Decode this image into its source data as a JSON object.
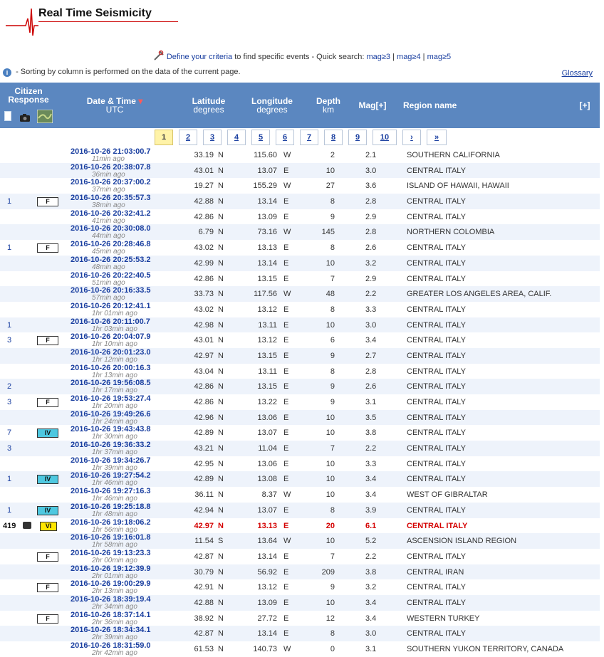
{
  "brand": {
    "title": "Real Time Seismicity"
  },
  "criteria": {
    "define_link": "Define your criteria",
    "text_mid": " to find specific events - Quick search: ",
    "mag3": "mag≥3",
    "mag4": "mag≥4",
    "mag5": "mag≥5",
    "sep": " | "
  },
  "info": {
    "text": "- Sorting by column is performed on the data of the current page.",
    "glossary": "Glossary"
  },
  "header": {
    "citizen": "Citizen",
    "response": "Response",
    "datetime": "Date & Time",
    "utc": "UTC",
    "latitude": "Latitude",
    "lat_unit": "degrees",
    "longitude": "Longitude",
    "lon_unit": "degrees",
    "depth": "Depth",
    "depth_unit": "km",
    "mag": "Mag[+]",
    "region": "Region name",
    "expand": "[+]",
    "sort_arrow": "▾"
  },
  "pager": [
    "1",
    "2",
    "3",
    "4",
    "5",
    "6",
    "7",
    "8",
    "9",
    "10",
    "›",
    "»"
  ],
  "events": [
    {
      "dt": "2016-10-26   21:03:00.7",
      "ago": "11min ago",
      "cnt": "",
      "badge": "",
      "lat": "33.19",
      "ns": "N",
      "lon": "115.60",
      "ew": "W",
      "dep": "2",
      "mag": "2.1",
      "reg": "SOUTHERN CALIFORNIA"
    },
    {
      "dt": "2016-10-26   20:38:07.8",
      "ago": "36min ago",
      "cnt": "",
      "badge": "",
      "lat": "43.01",
      "ns": "N",
      "lon": "13.07",
      "ew": "E",
      "dep": "10",
      "mag": "3.0",
      "reg": "CENTRAL ITALY"
    },
    {
      "dt": "2016-10-26   20:37:00.2",
      "ago": "37min ago",
      "cnt": "",
      "badge": "",
      "lat": "19.27",
      "ns": "N",
      "lon": "155.29",
      "ew": "W",
      "dep": "27",
      "mag": "3.6",
      "reg": "ISLAND OF HAWAII, HAWAII"
    },
    {
      "dt": "2016-10-26   20:35:57.3",
      "ago": "38min ago",
      "cnt": "1",
      "badge": "F",
      "lat": "42.88",
      "ns": "N",
      "lon": "13.14",
      "ew": "E",
      "dep": "8",
      "mag": "2.8",
      "reg": "CENTRAL ITALY"
    },
    {
      "dt": "2016-10-26   20:32:41.2",
      "ago": "41min ago",
      "cnt": "",
      "badge": "",
      "lat": "42.86",
      "ns": "N",
      "lon": "13.09",
      "ew": "E",
      "dep": "9",
      "mag": "2.9",
      "reg": "CENTRAL ITALY"
    },
    {
      "dt": "2016-10-26   20:30:08.0",
      "ago": "44min ago",
      "cnt": "",
      "badge": "",
      "lat": "6.79",
      "ns": "N",
      "lon": "73.16",
      "ew": "W",
      "dep": "145",
      "mag": "2.8",
      "reg": "NORTHERN COLOMBIA"
    },
    {
      "dt": "2016-10-26   20:28:46.8",
      "ago": "45min ago",
      "cnt": "1",
      "badge": "F",
      "lat": "43.02",
      "ns": "N",
      "lon": "13.13",
      "ew": "E",
      "dep": "8",
      "mag": "2.6",
      "reg": "CENTRAL ITALY"
    },
    {
      "dt": "2016-10-26   20:25:53.2",
      "ago": "48min ago",
      "cnt": "",
      "badge": "",
      "lat": "42.99",
      "ns": "N",
      "lon": "13.14",
      "ew": "E",
      "dep": "10",
      "mag": "3.2",
      "reg": "CENTRAL ITALY"
    },
    {
      "dt": "2016-10-26   20:22:40.5",
      "ago": "51min ago",
      "cnt": "",
      "badge": "",
      "lat": "42.86",
      "ns": "N",
      "lon": "13.15",
      "ew": "E",
      "dep": "7",
      "mag": "2.9",
      "reg": "CENTRAL ITALY"
    },
    {
      "dt": "2016-10-26   20:16:33.5",
      "ago": "57min ago",
      "cnt": "",
      "badge": "",
      "lat": "33.73",
      "ns": "N",
      "lon": "117.56",
      "ew": "W",
      "dep": "48",
      "mag": "2.2",
      "reg": "GREATER LOS ANGELES AREA, CALIF."
    },
    {
      "dt": "2016-10-26   20:12:41.1",
      "ago": "1hr 01min ago",
      "cnt": "",
      "badge": "",
      "lat": "43.02",
      "ns": "N",
      "lon": "13.12",
      "ew": "E",
      "dep": "8",
      "mag": "3.3",
      "reg": "CENTRAL ITALY"
    },
    {
      "dt": "2016-10-26   20:11:00.7",
      "ago": "1hr 03min ago",
      "cnt": "1",
      "badge": "",
      "lat": "42.98",
      "ns": "N",
      "lon": "13.11",
      "ew": "E",
      "dep": "10",
      "mag": "3.0",
      "reg": "CENTRAL ITALY"
    },
    {
      "dt": "2016-10-26   20:04:07.9",
      "ago": "1hr 10min ago",
      "cnt": "3",
      "badge": "F",
      "lat": "43.01",
      "ns": "N",
      "lon": "13.12",
      "ew": "E",
      "dep": "6",
      "mag": "3.4",
      "reg": "CENTRAL ITALY"
    },
    {
      "dt": "2016-10-26   20:01:23.0",
      "ago": "1hr 12min ago",
      "cnt": "",
      "badge": "",
      "lat": "42.97",
      "ns": "N",
      "lon": "13.15",
      "ew": "E",
      "dep": "9",
      "mag": "2.7",
      "reg": "CENTRAL ITALY"
    },
    {
      "dt": "2016-10-26   20:00:16.3",
      "ago": "1hr 13min ago",
      "cnt": "",
      "badge": "",
      "lat": "43.04",
      "ns": "N",
      "lon": "13.11",
      "ew": "E",
      "dep": "8",
      "mag": "2.8",
      "reg": "CENTRAL ITALY"
    },
    {
      "dt": "2016-10-26   19:56:08.5",
      "ago": "1hr 17min ago",
      "cnt": "2",
      "badge": "",
      "lat": "42.86",
      "ns": "N",
      "lon": "13.15",
      "ew": "E",
      "dep": "9",
      "mag": "2.6",
      "reg": "CENTRAL ITALY"
    },
    {
      "dt": "2016-10-26   19:53:27.4",
      "ago": "1hr 20min ago",
      "cnt": "3",
      "badge": "F",
      "lat": "42.86",
      "ns": "N",
      "lon": "13.22",
      "ew": "E",
      "dep": "9",
      "mag": "3.1",
      "reg": "CENTRAL ITALY"
    },
    {
      "dt": "2016-10-26   19:49:26.6",
      "ago": "1hr 24min ago",
      "cnt": "",
      "badge": "",
      "lat": "42.96",
      "ns": "N",
      "lon": "13.06",
      "ew": "E",
      "dep": "10",
      "mag": "3.5",
      "reg": "CENTRAL ITALY"
    },
    {
      "dt": "2016-10-26   19:43:43.8",
      "ago": "1hr 30min ago",
      "cnt": "7",
      "badge": "IV",
      "lat": "42.89",
      "ns": "N",
      "lon": "13.07",
      "ew": "E",
      "dep": "10",
      "mag": "3.8",
      "reg": "CENTRAL ITALY"
    },
    {
      "dt": "2016-10-26   19:36:33.2",
      "ago": "1hr 37min ago",
      "cnt": "3",
      "badge": "",
      "lat": "43.21",
      "ns": "N",
      "lon": "11.04",
      "ew": "E",
      "dep": "7",
      "mag": "2.2",
      "reg": "CENTRAL ITALY"
    },
    {
      "dt": "2016-10-26   19:34:26.7",
      "ago": "1hr 39min ago",
      "cnt": "",
      "badge": "",
      "lat": "42.95",
      "ns": "N",
      "lon": "13.06",
      "ew": "E",
      "dep": "10",
      "mag": "3.3",
      "reg": "CENTRAL ITALY"
    },
    {
      "dt": "2016-10-26   19:27:54.2",
      "ago": "1hr 46min ago",
      "cnt": "1",
      "badge": "IV",
      "lat": "42.89",
      "ns": "N",
      "lon": "13.08",
      "ew": "E",
      "dep": "10",
      "mag": "3.4",
      "reg": "CENTRAL ITALY"
    },
    {
      "dt": "2016-10-26   19:27:16.3",
      "ago": "1hr 46min ago",
      "cnt": "",
      "badge": "",
      "lat": "36.11",
      "ns": "N",
      "lon": "8.37",
      "ew": "W",
      "dep": "10",
      "mag": "3.4",
      "reg": "WEST OF GIBRALTAR"
    },
    {
      "dt": "2016-10-26   19:25:18.8",
      "ago": "1hr 48min ago",
      "cnt": "1",
      "badge": "IV",
      "lat": "42.94",
      "ns": "N",
      "lon": "13.07",
      "ew": "E",
      "dep": "8",
      "mag": "3.9",
      "reg": "CENTRAL ITALY"
    },
    {
      "dt": "2016-10-26   19:18:06.2",
      "ago": "1hr 56min ago",
      "cnt": "419",
      "badge": "VI",
      "big": true,
      "lat": "42.97",
      "ns": "N",
      "lon": "13.13",
      "ew": "E",
      "dep": "20",
      "mag": "6.1",
      "reg": "CENTRAL ITALY"
    },
    {
      "dt": "2016-10-26   19:16:01.8",
      "ago": "1hr 58min ago",
      "cnt": "",
      "badge": "",
      "lat": "11.54",
      "ns": "S",
      "lon": "13.64",
      "ew": "W",
      "dep": "10",
      "mag": "5.2",
      "reg": "ASCENSION ISLAND REGION"
    },
    {
      "dt": "2016-10-26   19:13:23.3",
      "ago": "2hr 00min ago",
      "cnt": "",
      "badge": "F",
      "lat": "42.87",
      "ns": "N",
      "lon": "13.14",
      "ew": "E",
      "dep": "7",
      "mag": "2.2",
      "reg": "CENTRAL ITALY"
    },
    {
      "dt": "2016-10-26   19:12:39.9",
      "ago": "2hr 01min ago",
      "cnt": "",
      "badge": "",
      "lat": "30.79",
      "ns": "N",
      "lon": "56.92",
      "ew": "E",
      "dep": "209",
      "mag": "3.8",
      "reg": "CENTRAL IRAN"
    },
    {
      "dt": "2016-10-26   19:00:29.9",
      "ago": "2hr 13min ago",
      "cnt": "",
      "badge": "F",
      "lat": "42.91",
      "ns": "N",
      "lon": "13.12",
      "ew": "E",
      "dep": "9",
      "mag": "3.2",
      "reg": "CENTRAL ITALY"
    },
    {
      "dt": "2016-10-26   18:39:19.4",
      "ago": "2hr 34min ago",
      "cnt": "",
      "badge": "",
      "lat": "42.88",
      "ns": "N",
      "lon": "13.09",
      "ew": "E",
      "dep": "10",
      "mag": "3.4",
      "reg": "CENTRAL ITALY"
    },
    {
      "dt": "2016-10-26   18:37:14.1",
      "ago": "2hr 36min ago",
      "cnt": "",
      "badge": "F",
      "lat": "38.92",
      "ns": "N",
      "lon": "27.72",
      "ew": "E",
      "dep": "12",
      "mag": "3.4",
      "reg": "WESTERN TURKEY"
    },
    {
      "dt": "2016-10-26   18:34:34.1",
      "ago": "2hr 39min ago",
      "cnt": "",
      "badge": "",
      "lat": "42.87",
      "ns": "N",
      "lon": "13.14",
      "ew": "E",
      "dep": "8",
      "mag": "3.0",
      "reg": "CENTRAL ITALY"
    },
    {
      "dt": "2016-10-26   18:31:59.0",
      "ago": "2hr 42min ago",
      "cnt": "",
      "badge": "",
      "lat": "61.53",
      "ns": "N",
      "lon": "140.73",
      "ew": "W",
      "dep": "0",
      "mag": "3.1",
      "reg": "SOUTHERN YUKON TERRITORY, CANADA"
    }
  ]
}
